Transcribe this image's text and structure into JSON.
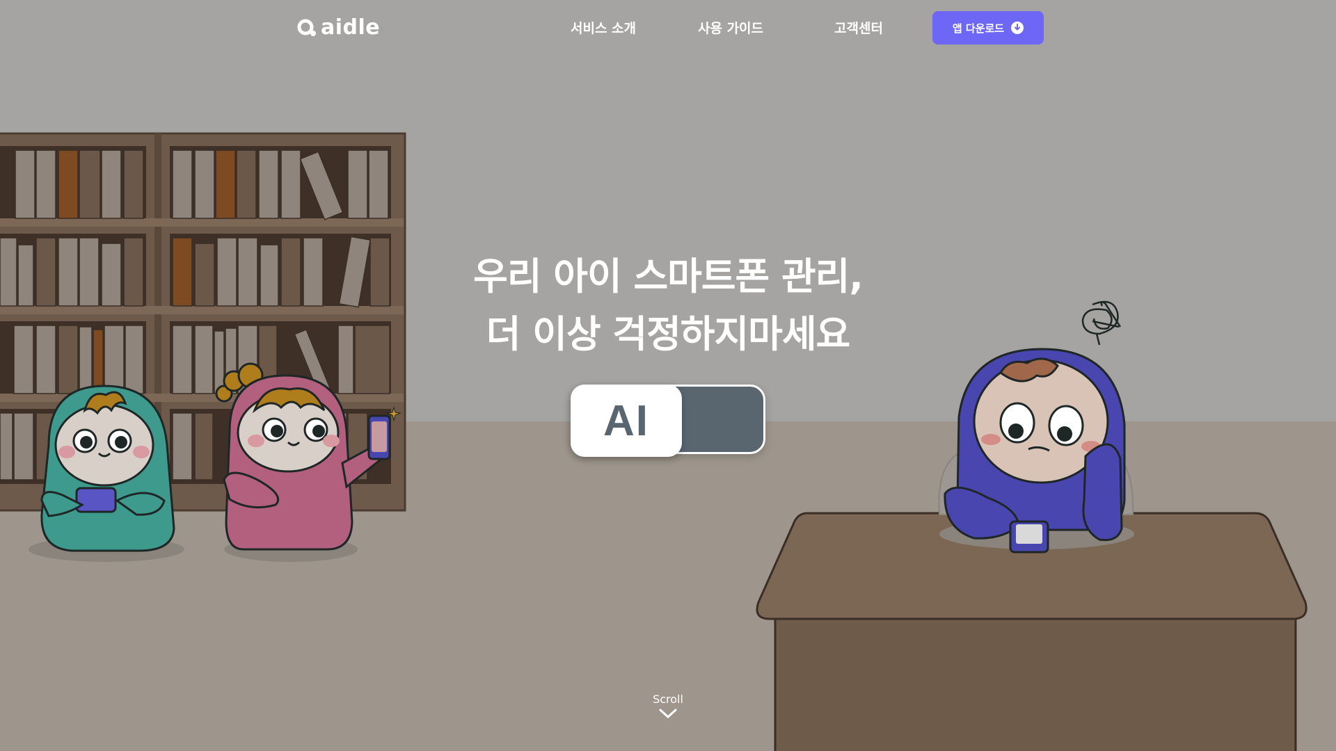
{
  "header": {
    "logo_text": "aidle",
    "nav": [
      {
        "label": "서비스 소개"
      },
      {
        "label": "사용 가이드"
      },
      {
        "label": "고객센터"
      }
    ],
    "download_label": "앱 다운로드"
  },
  "hero": {
    "line1": "우리 아이 스마트폰 관리,",
    "line2": "더 이상 걱정하지마세요",
    "toggle_label": "AI"
  },
  "scroll_label": "Scroll",
  "colors": {
    "accent": "#6e66f5",
    "toggle_track": "#596670",
    "teal_character": "#3f9a8e",
    "pink_character": "#b2607d",
    "blue_character": "#4a46b0"
  }
}
